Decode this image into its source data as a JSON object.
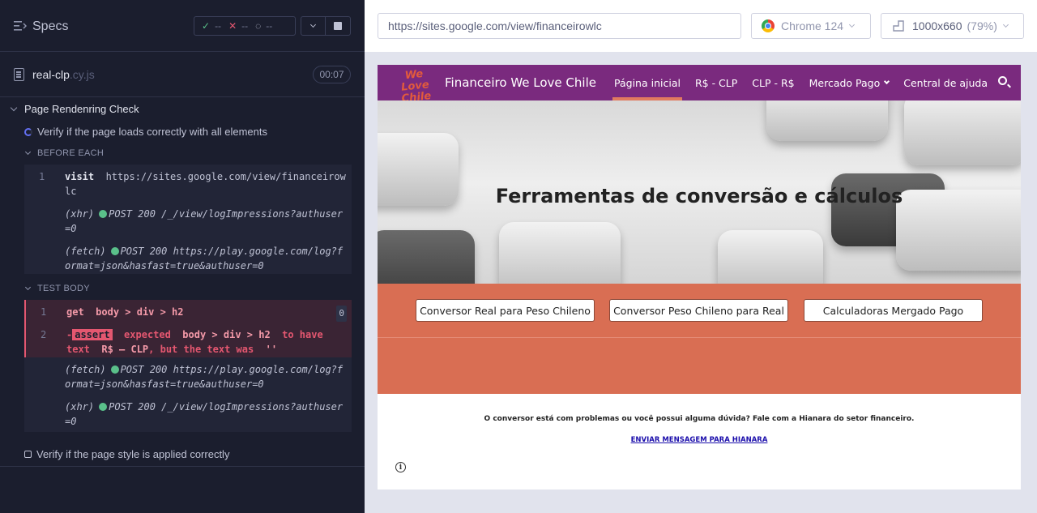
{
  "runner": {
    "title": "Specs",
    "stats": {
      "passed": "--",
      "failed": "--",
      "pending": "--"
    },
    "file": {
      "name": "real-clp",
      "ext": ".cy.js",
      "duration": "00:07"
    },
    "suite": "Page Rendenring Check",
    "test1": "Verify if the page loads correctly with all elements",
    "before_each_label": "BEFORE EACH",
    "test_body_label": "TEST BODY",
    "test2": "Verify if the page style is applied correctly",
    "before_each": [
      {
        "num": "1",
        "cmd": "visit",
        "arg": "https://sites.google.com/view/financeirowlc"
      },
      {
        "type": "(xhr)",
        "text": "POST 200 /_/view/logImpressions?authuser=0"
      },
      {
        "type": "(fetch)",
        "text": "POST 200 https://play.google.com/log?format=json&hasfast=true&authuser=0"
      }
    ],
    "test_body": {
      "get": {
        "num": "1",
        "cmd": "get",
        "arg": "body > div > h2",
        "badge": "0"
      },
      "assert": {
        "num": "2",
        "dash": "-",
        "tag": "assert",
        "p1": "expected",
        "sel": "body > div > h2",
        "p2": "to have text",
        "expected": "R$ – CLP",
        "p3": ", but the text was",
        "actual": "''"
      },
      "fetch": {
        "type": "(fetch)",
        "text": "POST 200 https://play.google.com/log?format=json&hasfast=true&authuser=0"
      },
      "xhr": {
        "type": "(xhr)",
        "text": "POST 200 /_/view/logImpressions?authuser=0"
      }
    }
  },
  "browser": {
    "url": "https://sites.google.com/view/financeirowlc",
    "name": "Chrome 124",
    "viewport": "1000x660",
    "zoom": "(79%)"
  },
  "site": {
    "logo_line1": "We Love",
    "logo_line2": "Chile",
    "title": "Financeiro We Love Chile",
    "nav": [
      "Página inicial",
      "R$ - CLP",
      "CLP - R$",
      "Mercado Pago",
      "Central de ajuda"
    ],
    "hero_title": "Ferramentas de conversão e cálculos",
    "buttons": [
      "Conversor Real para Peso Chileno",
      "Conversor Peso Chileno para Real",
      "Calculadoras Mergado Pago"
    ],
    "footer_msg": "O conversor está com problemas ou você possui alguma dúvida? Fale com a Hianara do setor financeiro.",
    "footer_link": "ENVIAR MENSAGEM PARA HIANARA",
    "colors": {
      "nav": "#7a2a7e",
      "accent": "#d96e53"
    }
  }
}
